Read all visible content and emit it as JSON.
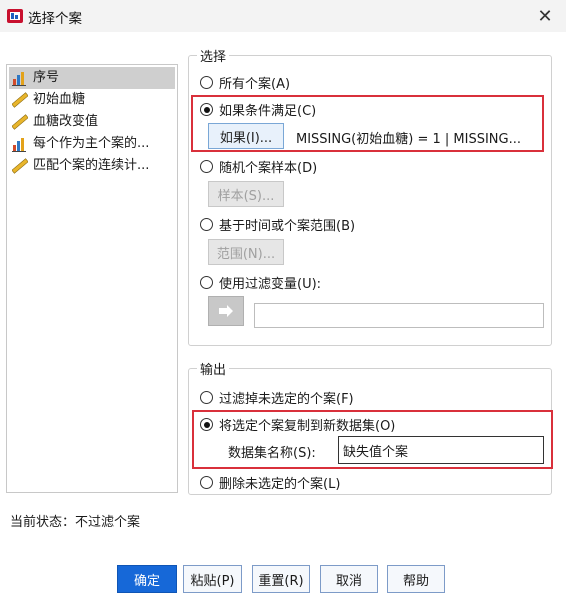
{
  "window": {
    "title": "选择个案"
  },
  "variables": [
    {
      "label": "序号",
      "icon": "bar-chart-icon"
    },
    {
      "label": "初始血糖",
      "icon": "ruler-icon"
    },
    {
      "label": "血糖改变值",
      "icon": "ruler-icon"
    },
    {
      "label": "每个作为主个案的...",
      "icon": "bar-chart-icon"
    },
    {
      "label": "匹配个案的连续计...",
      "icon": "ruler-icon"
    }
  ],
  "select_group": {
    "title": "选择",
    "all_cases": "所有个案(A)",
    "if_condition": "如果条件满足(C)",
    "if_button": "如果(I)...",
    "condition_text": "MISSING(初始血糖) = 1 | MISSING...",
    "random_sample": "随机个案样本(D)",
    "sample_button": "样本(S)...",
    "time_range": "基于时间或个案范围(B)",
    "range_button": "范围(N)...",
    "filter_variable": "使用过滤变量(U):"
  },
  "output_group": {
    "title": "输出",
    "filter_out": "过滤掉未选定的个案(F)",
    "copy_to_new": "将选定个案复制到新数据集(O)",
    "dataset_name_label": "数据集名称(S):",
    "dataset_name_value": "缺失值个案",
    "delete_unselected": "删除未选定的个案(L)"
  },
  "status": "当前状态：不过滤个案",
  "footer": {
    "ok": "确定",
    "paste": "粘贴(P)",
    "reset": "重置(R)",
    "cancel": "取消",
    "help": "帮助"
  },
  "colors": {
    "highlight_box": "#d9303b",
    "primary_button": "#1668d8"
  }
}
